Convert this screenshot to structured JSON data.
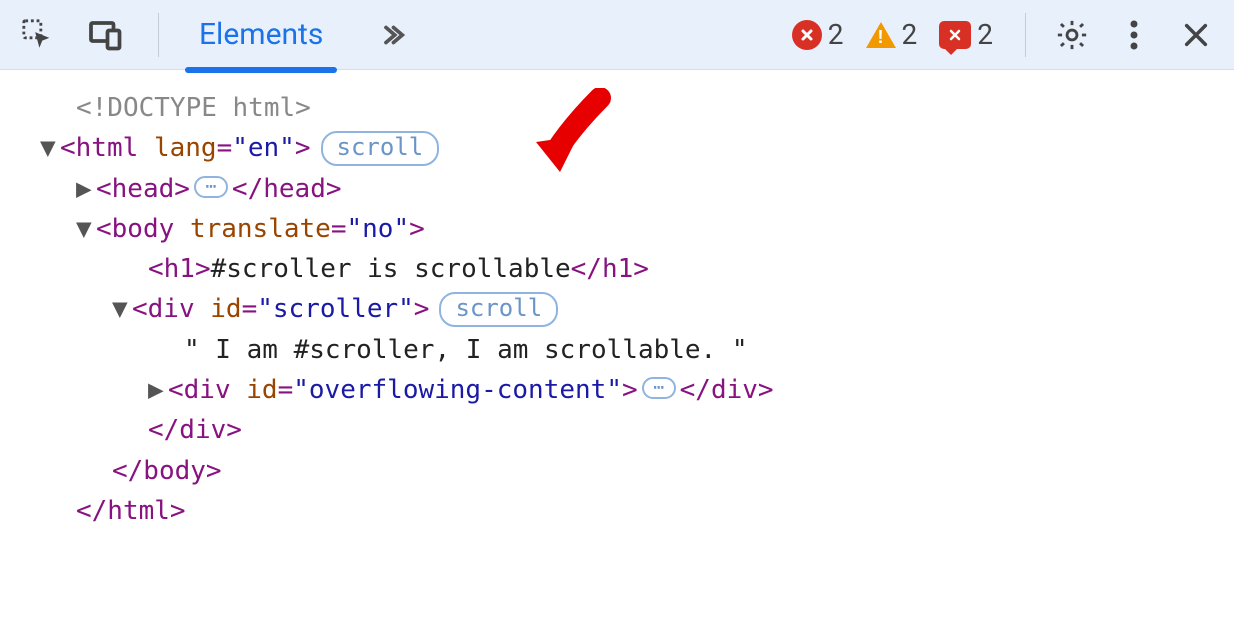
{
  "toolbar": {
    "tab_elements": "Elements",
    "errors_count": "2",
    "warnings_count": "2",
    "issues_count": "2"
  },
  "tree": {
    "doctype": "<!DOCTYPE html>",
    "html_open_1": "<",
    "html_tag": "html",
    "html_attr_name": "lang",
    "html_attr_val": "\"en\"",
    "html_open_2": ">",
    "scroll_badge": "scroll",
    "head_open": "<head>",
    "head_close": "</head>",
    "body_open_1": "<",
    "body_tag": "body",
    "body_attr_name": "translate",
    "body_attr_val": "\"no\"",
    "body_open_2": ">",
    "h1_open": "<h1>",
    "h1_text": "#scroller is scrollable",
    "h1_close": "</h1>",
    "div_open_1": "<",
    "div_tag": "div",
    "div_attr_name": "id",
    "div_attr_val": "\"scroller\"",
    "div_open_2": ">",
    "scroller_text": "\" I am #scroller, I am scrollable. \"",
    "div2_open_1": "<",
    "div2_tag": "div",
    "div2_attr_name": "id",
    "div2_attr_val": "\"overflowing-content\"",
    "div2_open_2": ">",
    "div2_close": "</div>",
    "div_close": "</div>",
    "body_close": "</body>",
    "html_close": "</html>",
    "dots": "⋯"
  }
}
